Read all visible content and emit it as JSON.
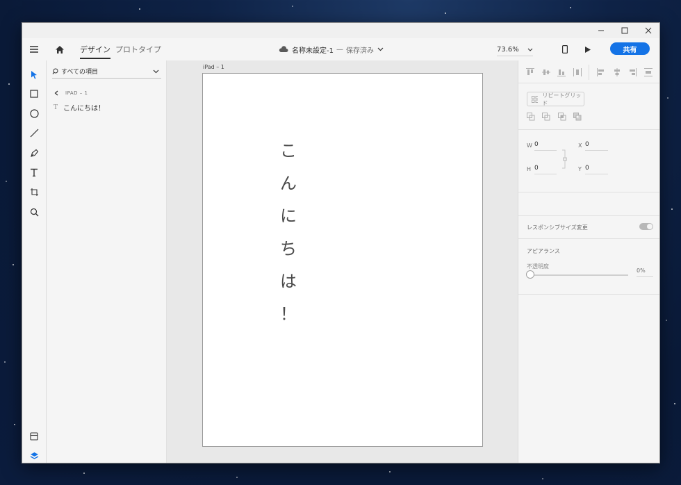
{
  "window": {
    "file_title": "名称未設定-1",
    "save_status": "保存済み",
    "separator": "—"
  },
  "toolbar": {
    "tabs": [
      {
        "label": "デザイン",
        "active": true
      },
      {
        "label": "プロトタイプ",
        "active": false
      }
    ],
    "zoom": "73.6%",
    "share_label": "共有"
  },
  "left_tools": [
    "select-icon",
    "rectangle-icon",
    "ellipse-icon",
    "line-icon",
    "pen-icon",
    "text-icon",
    "artboard-icon",
    "zoom-icon",
    "assets-icon",
    "layers-icon"
  ],
  "layers": {
    "search_label": "すべての項目",
    "artboard_crumb": "IPAD – 1",
    "items": [
      {
        "type_glyph": "T",
        "label": "こんにちは！"
      }
    ]
  },
  "canvas": {
    "artboard_label": "iPad – 1",
    "text_chars": [
      "こ",
      "ん",
      "に",
      "ち",
      "は",
      "！"
    ]
  },
  "properties": {
    "repeat_grid_label": "リピートグリッド",
    "w_label": "W",
    "w_value": "0",
    "h_label": "H",
    "h_value": "0",
    "x_label": "X",
    "x_value": "0",
    "y_label": "Y",
    "y_value": "0",
    "responsive_label": "レスポンシブサイズ変更",
    "responsive_on": true,
    "appearance_label": "アピアランス",
    "opacity_label": "不透明度",
    "opacity_value": "0%"
  },
  "colors": {
    "accent": "#1473e6",
    "canvas_bg": "#e8e8e8",
    "panel_bg": "#f5f5f5"
  }
}
